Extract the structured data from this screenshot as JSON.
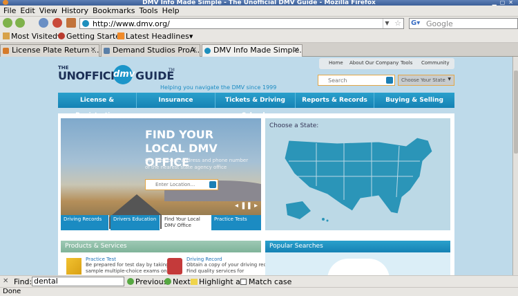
{
  "window": {
    "title": "DMV Info Made Simple - The Unofficial DMV Guide - Mozilla Firefox"
  },
  "menu": [
    "File",
    "Edit",
    "View",
    "History",
    "Bookmarks",
    "Tools",
    "Help"
  ],
  "nav": {
    "url": "http://www.dmv.org/",
    "search_placeholder": "Google"
  },
  "bookmarks": [
    {
      "label": "Most Visited",
      "icon": "bookmark-folder-icon"
    },
    {
      "label": "Getting Started",
      "icon": "firefox-icon"
    },
    {
      "label": "Latest Headlines",
      "icon": "rss-icon"
    }
  ],
  "tabs": [
    {
      "label": "License Plate Return ...",
      "active": false
    },
    {
      "label": "Demand Studios ProA...",
      "active": false
    },
    {
      "label": "DMV Info Made Simple...",
      "active": true
    }
  ],
  "site": {
    "logo": {
      "the": "THE",
      "unofficial": "UNOFFICIAL",
      "dmv": "dmv",
      "guide": "GUIDE",
      "tm": "TM"
    },
    "tagline": "Helping you navigate the DMV since 1999",
    "top_links": [
      "Home",
      "About Our Company",
      "Tools",
      "Community"
    ],
    "search_placeholder": "Search",
    "state_select": "Choose Your State",
    "main_nav": [
      "License & Registration",
      "Insurance",
      "Tickets & Driving Schools",
      "Reports & Records",
      "Buying & Selling"
    ],
    "hero": {
      "title": "FIND YOUR LOCAL DMV OFFICE",
      "subtitle": "Get the hours, address and phone number of the nearest state agency office",
      "input_placeholder": "Enter Location...",
      "tabs": [
        "Driving Records",
        "Drivers Education",
        "Find Your Local DMV Office",
        "Practice Tests"
      ]
    },
    "map_label": "Choose a State:",
    "products": {
      "header": "Products & Services",
      "items": [
        {
          "title": "Practice Test",
          "desc": "Be prepared for test day by taking sample multiple-choice exams on"
        },
        {
          "title": "Driving Record",
          "desc": "Obtain a copy of your driving record. Find quality services for"
        }
      ]
    },
    "popular_header": "Popular Searches"
  },
  "findbar": {
    "label": "Find:",
    "value": "dental",
    "previous": "Previous",
    "next": "Next",
    "highlight": "Highlight all",
    "match_case": "Match case"
  },
  "status": "Done"
}
